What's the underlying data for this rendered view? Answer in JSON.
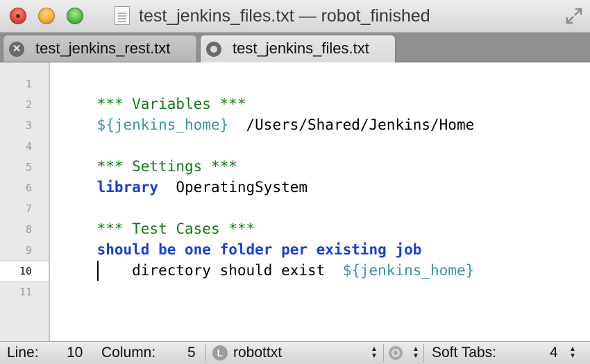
{
  "window": {
    "title": "test_jenkins_files.txt — robot_finished"
  },
  "tabs": [
    {
      "label": "test_jenkins_rest.txt",
      "active": false,
      "icon": "close-icon"
    },
    {
      "label": "test_jenkins_files.txt",
      "active": true,
      "icon": "modified-dot-icon"
    }
  ],
  "editor": {
    "line_numbers": [
      "1",
      "2",
      "3",
      "4",
      "5",
      "6",
      "7",
      "8",
      "9",
      "10",
      "11"
    ],
    "current_line": "10",
    "lines": {
      "l1": {
        "header": "*** Variables ***"
      },
      "l2": {
        "var": "${jenkins_home}",
        "value": "  /Users/Shared/Jenkins/Home"
      },
      "l4": {
        "header": "*** Settings ***"
      },
      "l5": {
        "keyword": "library",
        "value": "  OperatingSystem"
      },
      "l7": {
        "header": "*** Test Cases ***"
      },
      "l8": {
        "keyword": "should be one folder per existing job"
      },
      "l9": {
        "text": "    directory should exist  ",
        "var": "${jenkins_home}"
      }
    }
  },
  "statusbar": {
    "line_label": "Line:",
    "line_value": "10",
    "column_label": "Column:",
    "column_value": "5",
    "language_badge": "L",
    "language": "robottxt",
    "tabs_label": "Soft Tabs:",
    "tabs_value": "4"
  },
  "colors": {
    "header": "#127a12",
    "variable": "#3a95a0",
    "keyword": "#1a3fd6"
  }
}
